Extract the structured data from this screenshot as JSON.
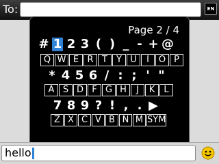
{
  "header": {
    "to_label": "To:",
    "to_value": "",
    "language_badge": "EN"
  },
  "symbol_popup": {
    "page_indicator": "Page 2 / 4",
    "selected_symbol": "1",
    "symbol_rows": [
      [
        "#",
        "1",
        "2",
        "3",
        "(",
        ")",
        "_",
        "-",
        "+",
        "@"
      ],
      [
        "*",
        "4",
        "5",
        "6",
        "/",
        ":",
        ";",
        "'",
        "\""
      ],
      [
        "7",
        "8",
        "9",
        "?",
        "!",
        ",",
        ".",
        "▶"
      ]
    ],
    "key_rows": [
      [
        "Q",
        "W",
        "E",
        "R",
        "T",
        "Y",
        "U",
        "I",
        "O",
        "P"
      ],
      [
        "A",
        "S",
        "D",
        "F",
        "G",
        "H",
        "J",
        "K",
        "L"
      ],
      [
        "Z",
        "X",
        "C",
        "V",
        "B",
        "N",
        "M",
        "SYM"
      ]
    ]
  },
  "compose": {
    "text": "hello",
    "smiley_icon": "smiley-face-icon"
  },
  "colors": {
    "selection": "#2f82d6",
    "popup_background": "#000000",
    "smiley": "#f5c400"
  }
}
